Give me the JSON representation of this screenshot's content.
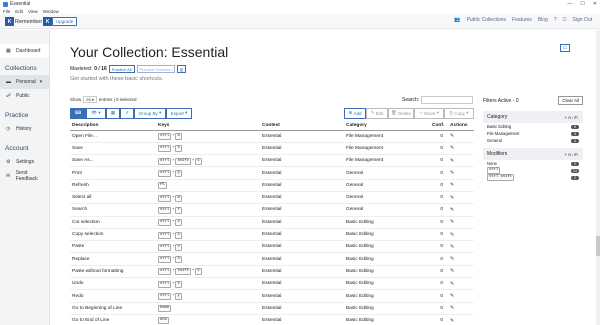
{
  "window": {
    "title": "Essential",
    "min": "—",
    "max": "☐",
    "close": "✕"
  },
  "menu": [
    "File",
    "Edit",
    "View",
    "Window"
  ],
  "topnav": {
    "logo_left": "K",
    "logo_text": "Remember",
    "logo_right": "K",
    "upgrade": "Upgrade",
    "links": [
      "Public Collections",
      "Features",
      "Blog",
      "Sign Out"
    ]
  },
  "sidebar": {
    "dashboard": "Dashboard",
    "collections_head": "Collections",
    "personal": "Personal",
    "public": "Public",
    "practice_head": "Practice",
    "history": "History",
    "account_head": "Account",
    "settings": "Settings",
    "feedback": "Send Feedback"
  },
  "main": {
    "title": "Your Collection: Essential",
    "mastered_label": "Mastered:",
    "mastered_value": "0 / 16",
    "practice_all": "Practice All",
    "practice_selection": "Practice Selection",
    "subtitle": "Get started with these basic shortcuts.",
    "show": "Show",
    "show_value": "25",
    "entries": "entries | 0 selected",
    "search_label": "Search:"
  },
  "toolbar": {
    "group_by": "Group By",
    "export": "Export",
    "add": "Add",
    "edit": "Edit",
    "delete": "Delete",
    "move": "Move",
    "copy": "Copy"
  },
  "table": {
    "headers": [
      "Description",
      "Keys",
      "Context",
      "Category",
      "Conf.",
      "Actions"
    ],
    "rows": [
      {
        "desc": "Open File...",
        "keys": [
          "ctrl",
          "o"
        ],
        "context": "Essential",
        "category": "File Management",
        "conf": "0"
      },
      {
        "desc": "Save",
        "keys": [
          "ctrl",
          "s"
        ],
        "context": "Essential",
        "category": "File Management",
        "conf": "0"
      },
      {
        "desc": "Save As...",
        "keys": [
          "ctrl",
          "shift",
          "s"
        ],
        "context": "Essential",
        "category": "File Management",
        "conf": "0"
      },
      {
        "desc": "Print",
        "keys": [
          "ctrl",
          "p"
        ],
        "context": "Essential",
        "category": "General",
        "conf": "0"
      },
      {
        "desc": "Refresh",
        "keys": [
          "F5"
        ],
        "context": "Essential",
        "category": "General",
        "conf": "0"
      },
      {
        "desc": "Select all",
        "keys": [
          "ctrl",
          "a"
        ],
        "context": "Essential",
        "category": "General",
        "conf": "0"
      },
      {
        "desc": "Search",
        "keys": [
          "ctrl",
          "f"
        ],
        "context": "Essential",
        "category": "General",
        "conf": "0"
      },
      {
        "desc": "Cut selection",
        "keys": [
          "ctrl",
          "x"
        ],
        "context": "Essential",
        "category": "Basic Editing",
        "conf": "0"
      },
      {
        "desc": "Copy selection",
        "keys": [
          "ctrl",
          "c"
        ],
        "context": "Essential",
        "category": "Basic Editing",
        "conf": "0"
      },
      {
        "desc": "Paste",
        "keys": [
          "ctrl",
          "v"
        ],
        "context": "Essential",
        "category": "Basic Editing",
        "conf": "0"
      },
      {
        "desc": "Replace",
        "keys": [
          "ctrl",
          "h"
        ],
        "context": "Essential",
        "category": "Basic Editing",
        "conf": "0"
      },
      {
        "desc": "Paste without formatting",
        "keys": [
          "ctrl",
          "shift",
          "v"
        ],
        "context": "Essential",
        "category": "Basic Editing",
        "conf": "0"
      },
      {
        "desc": "Undo",
        "keys": [
          "ctrl",
          "z"
        ],
        "context": "Essential",
        "category": "Basic Editing",
        "conf": "0"
      },
      {
        "desc": "Redo",
        "keys": [
          "ctrl",
          "y"
        ],
        "context": "Essential",
        "category": "Basic Editing",
        "conf": "0"
      },
      {
        "desc": "Go to Beginning of Line",
        "keys": [
          "home"
        ],
        "context": "Essential",
        "category": "Basic Editing",
        "conf": "0"
      },
      {
        "desc": "Go to End of Line",
        "keys": [
          "end"
        ],
        "context": "Essential",
        "category": "Basic Editing",
        "conf": "0"
      }
    ]
  },
  "filters": {
    "active": "Filters Active - 0",
    "clear": "Clear All",
    "category_head": "Category",
    "categories": [
      {
        "name": "Basic Editing",
        "count": "9"
      },
      {
        "name": "File Management",
        "count": "3"
      },
      {
        "name": "General",
        "count": "4"
      }
    ],
    "modifiers_head": "Modifiers",
    "modifiers": [
      {
        "name": "None",
        "count": "2"
      },
      {
        "name": "ctrl",
        "count": "14"
      },
      {
        "name": "ctrl shift",
        "count": "2"
      }
    ]
  }
}
